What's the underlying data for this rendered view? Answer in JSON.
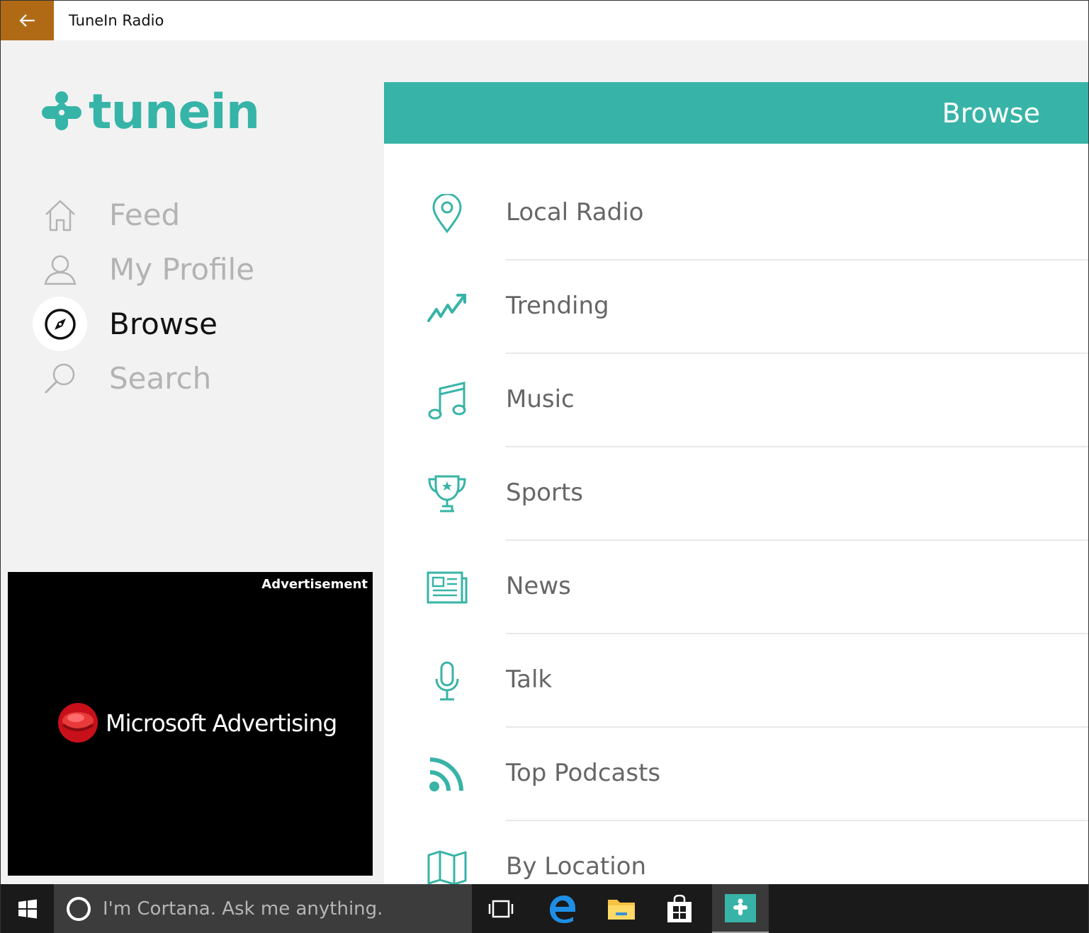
{
  "window": {
    "title": "TuneIn Radio"
  },
  "logo": {
    "text": "tunein"
  },
  "nav": {
    "items": [
      {
        "label": "Feed",
        "icon": "home-icon"
      },
      {
        "label": "My Profile",
        "icon": "user-icon"
      },
      {
        "label": "Browse",
        "icon": "compass-icon",
        "active": true
      },
      {
        "label": "Search",
        "icon": "search-icon"
      }
    ]
  },
  "ad": {
    "label": "Advertisement",
    "brand": "Microsoft Advertising"
  },
  "browse": {
    "title": "Browse",
    "items": [
      {
        "label": "Local Radio",
        "icon": "map-pin-icon"
      },
      {
        "label": "Trending",
        "icon": "trending-icon"
      },
      {
        "label": "Music",
        "icon": "music-note-icon"
      },
      {
        "label": "Sports",
        "icon": "trophy-icon"
      },
      {
        "label": "News",
        "icon": "newspaper-icon"
      },
      {
        "label": "Talk",
        "icon": "microphone-icon"
      },
      {
        "label": "Top Podcasts",
        "icon": "podcast-icon"
      },
      {
        "label": "By Location",
        "icon": "map-icon"
      }
    ]
  },
  "taskbar": {
    "search_placeholder": "I'm Cortana. Ask me anything."
  },
  "colors": {
    "accent": "#37b4a7",
    "back_button": "#b06a16"
  }
}
